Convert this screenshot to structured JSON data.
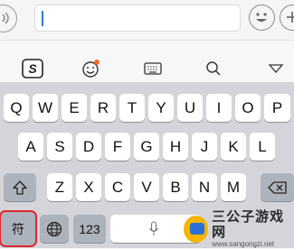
{
  "chatbar": {
    "input_value": "",
    "icons": [
      "voice-icon",
      "emoji-icon",
      "add-icon"
    ]
  },
  "toolbar": {
    "icons": [
      "sogou-logo-icon",
      "emoji-face-icon",
      "keyboard-icon",
      "search-icon",
      "collapse-icon"
    ],
    "notification_color": "#f26b22"
  },
  "keyboard": {
    "row1": [
      "Q",
      "W",
      "E",
      "R",
      "T",
      "Y",
      "U",
      "I",
      "O",
      "P"
    ],
    "row2": [
      "A",
      "S",
      "D",
      "F",
      "G",
      "H",
      "J",
      "K",
      "L"
    ],
    "row3": [
      "Z",
      "X",
      "C",
      "V",
      "B",
      "N",
      "M"
    ],
    "symbol_key": "符",
    "number_key": "123",
    "highlight_color": "#e0262e"
  },
  "watermark": {
    "title": "三公子游戏网",
    "url": "www.sangongzi.net"
  }
}
